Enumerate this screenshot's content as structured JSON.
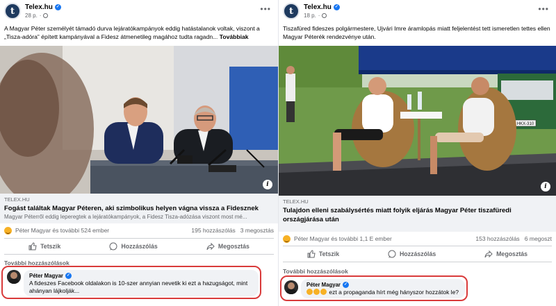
{
  "posts": [
    {
      "page_name": "Telex.hu",
      "avatar_letter": "t",
      "time": "28 p.",
      "text": "A Magyar Péter személyét támadó durva lejáratókampányok eddig hatástalanok voltak, viszont a „Tisza-adóra” épített kampányával a Fidesz átmenetileg magához tudta ragadn...",
      "see_more": "Továbbiak",
      "link_domain": "TELEX.HU",
      "link_title": "Fogást találtak Magyar Péteren, aki szimbolikus helyen vágna vissza a Fidesznek",
      "link_desc": "Magyar Péterről eddig leperegtek a lejáratókampányok, a Fidesz Tisza-adózása viszont most mé...",
      "reactions_text": "Péter Magyar és további 524 ember",
      "comments_count": "195 hozzászólás",
      "shares_count": "3 megosztás",
      "actions": {
        "like": "Tetszik",
        "comment": "Hozzászólás",
        "share": "Megosztás"
      },
      "more_comments": "További hozzászólások",
      "comment": {
        "author": "Péter Magyar",
        "text": "A fideszes Facebook oldalakon is 10-szer annyian nevetik ki ezt a hazugságot, mint ahányan lájkolják..."
      }
    },
    {
      "page_name": "Telex.hu",
      "avatar_letter": "t",
      "time": "18 p.",
      "text": "Tiszafüred fideszes polgármestere, Ujvári Imre áramlopás miatt feljelentést tett ismeretlen tettes ellen Magyar Péterék rendezvénye után.",
      "see_more": "",
      "link_domain": "TELEX.HU",
      "link_title": "Tulajdon elleni szabálysértés miatt folyik eljárás Magyar Péter tiszafüredi országjárása után",
      "link_desc": "",
      "reactions_text": "Péter Magyar és további 1,1 E ember",
      "comments_count": "153 hozzászólás",
      "shares_count": "6 megoszt",
      "actions": {
        "like": "Tetszik",
        "comment": "Hozzászólás",
        "share": "Megosztás"
      },
      "more_comments": "További hozzászólások",
      "comment": {
        "author": "Péter Magyar",
        "text": "ezt a propaganda hírt még hányszor hozzátok le?"
      },
      "truck_plate": "HKX-310"
    }
  ],
  "colors": {
    "highlight": "#d93a3a",
    "verified": "#1877f2",
    "meta_text": "#65676b",
    "preview_bg": "#f0f2f5"
  }
}
